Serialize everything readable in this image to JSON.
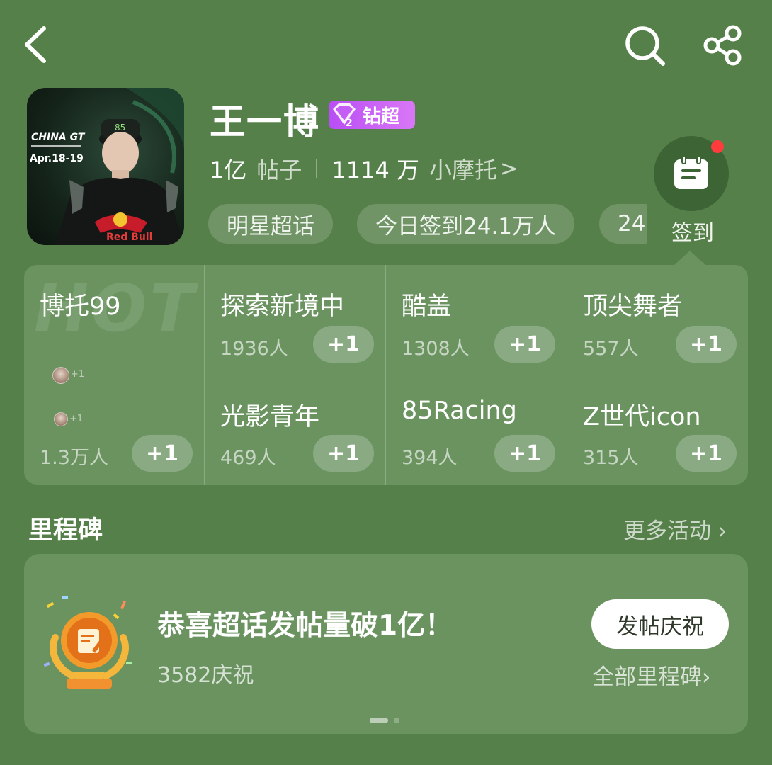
{
  "header": {
    "title": "王一博",
    "level_badge": "钻超",
    "level_number": "2",
    "posts_count": "1亿",
    "posts_label": "帖子",
    "followers_count": "1114 万",
    "followers_label": "小摩托",
    "chevron": ">",
    "chips": [
      "明星超话",
      "今日签到24.1万人",
      "24"
    ],
    "checkin_label": "签到",
    "cover_texts": [
      "CHINA GT",
      "Apr.18-19",
      "Red Bull",
      "85"
    ]
  },
  "topics": {
    "hot_watermark": "HOT",
    "featured": {
      "name": "博托99",
      "count": "1.3万人",
      "btn": "+1",
      "mini_plus": "+1"
    },
    "items": [
      {
        "name": "探索新境中",
        "count": "1936人",
        "btn": "+1"
      },
      {
        "name": "酷盖",
        "count": "1308人",
        "btn": "+1"
      },
      {
        "name": "顶尖舞者",
        "count": "557人",
        "btn": "+1"
      },
      {
        "name": "光影青年",
        "count": "469人",
        "btn": "+1"
      },
      {
        "name": "85Racing",
        "count": "394人",
        "btn": "+1"
      },
      {
        "name": "Z世代icon",
        "count": "315人",
        "btn": "+1"
      }
    ]
  },
  "milestone": {
    "section_title": "里程碑",
    "more_label": "更多活动 ›",
    "headline": "恭喜超话发帖量破1亿！",
    "celebrations": "3582庆祝",
    "post_button": "发帖庆祝",
    "all_label": "全部里程碑›"
  },
  "colors": {
    "background": "#56804a",
    "card": "#6a9360",
    "badge": "#c45ef5",
    "notify_dot": "#ff3b3b"
  },
  "icons": [
    "back-arrow-icon",
    "search-icon",
    "share-icon",
    "calendar-icon",
    "trophy-icon",
    "diamond-icon"
  ]
}
